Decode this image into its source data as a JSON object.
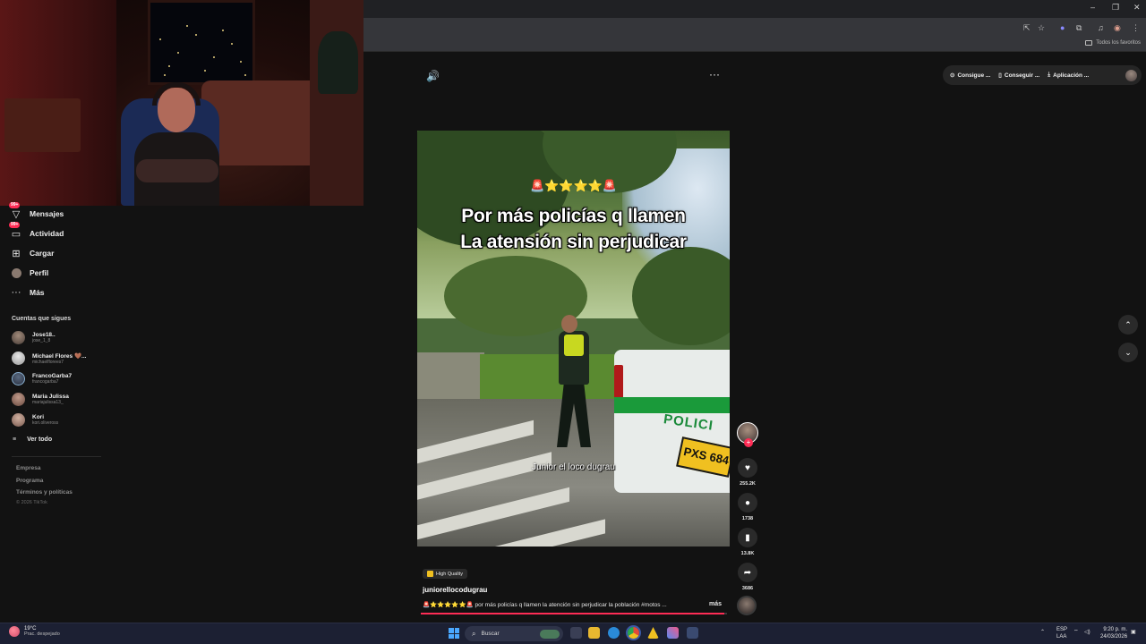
{
  "colors": {
    "accent": "#fe2c55",
    "background": "#121212",
    "taskbar": "#1c2033"
  },
  "sidebar": {
    "nav": [
      {
        "label": "Mensajes",
        "icon": "send-icon",
        "badge": "99+"
      },
      {
        "label": "Actividad",
        "icon": "inbox-icon",
        "badge": "99+"
      },
      {
        "label": "Cargar",
        "icon": "plus-square-icon"
      },
      {
        "label": "Perfil",
        "icon": "avatar-icon"
      },
      {
        "label": "Más",
        "icon": "more-icon"
      }
    ],
    "following_title": "Cuentas que sigues",
    "following": [
      {
        "name": "Jose18..",
        "handle": "jose_1_8"
      },
      {
        "name": "Michael Flores 🤎...",
        "handle": "michaelflorees7"
      },
      {
        "name": "FrancoGarba7",
        "handle": "francogarba7"
      },
      {
        "name": "Maria Julissa",
        "handle": "mariajulissa13_"
      },
      {
        "name": "Kori",
        "handle": "kori.oliveross"
      }
    ],
    "see_all": "Ver todo",
    "footer": [
      "Empresa",
      "Programa",
      "Términos y políticas"
    ],
    "copyright": "© 2026 TikTok"
  },
  "browser": {
    "bookmarks_all": "Todos los favoritos"
  },
  "header": {
    "pill": [
      "Consigue ...",
      "Conseguir ...",
      "Aplicación ..."
    ]
  },
  "video": {
    "emoji_line": "🚨⭐⭐⭐⭐🚨",
    "caption_1": "Por más policías q llamen",
    "caption_2": "La atensión sin perjudicar",
    "subtitle": "Junior el loco dugrau",
    "truck_text": "POLICI",
    "plate": "PXS 684",
    "progress": 0.99
  },
  "actions": {
    "likes": "255.2K",
    "comments": "1738",
    "saves": "13.8K",
    "shares": "3686"
  },
  "post": {
    "badge": "High Quality",
    "username": "juniorellocodugrau",
    "description": "🚨⭐⭐⭐⭐⭐🚨 por más policías q llamen la atención sin perjudicar la población #motos ...",
    "more": "más"
  },
  "taskbar": {
    "temp": "19°C",
    "weather": "Prac. despejado",
    "search": "Buscar",
    "lang1": "ESP",
    "lang2": "LAA",
    "time": "9:20 p. m.",
    "date": "24/03/2026"
  }
}
